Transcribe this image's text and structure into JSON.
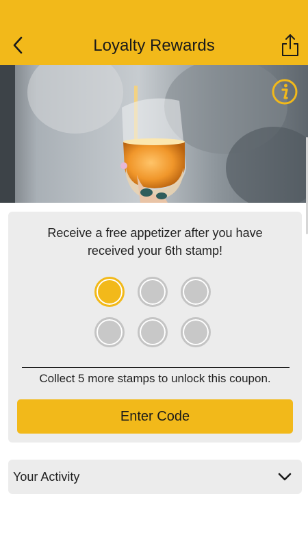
{
  "header": {
    "title": "Loyalty Rewards",
    "back_icon": "chevron-left-icon",
    "share_icon": "share-icon",
    "background_color": "#F2B91A"
  },
  "hero": {
    "image_subject": "beer-pouring-into-glass-photo",
    "info_icon": "info-icon"
  },
  "reward": {
    "description": "Receive a free appetizer after you have received your 6th stamp!",
    "stamps_total": 6,
    "stamps_collected": 1,
    "progress_message": "Collect 5 more stamps to unlock this coupon.",
    "enter_code_label": "Enter Code",
    "accent_color": "#F2B91A"
  },
  "activity": {
    "label": "Your Activity",
    "chevron_icon": "chevron-down-icon"
  }
}
